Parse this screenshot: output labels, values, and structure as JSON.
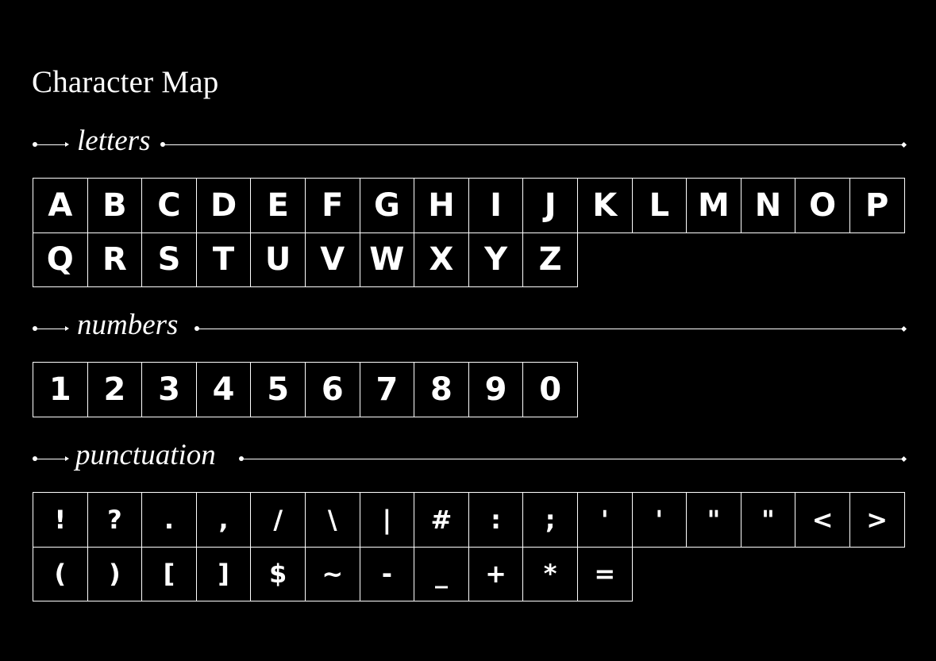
{
  "title": "Character Map",
  "sections": [
    {
      "label": "letters",
      "chars": [
        "A",
        "B",
        "C",
        "D",
        "E",
        "F",
        "G",
        "H",
        "I",
        "J",
        "K",
        "L",
        "M",
        "N",
        "O",
        "P",
        "Q",
        "R",
        "S",
        "T",
        "U",
        "V",
        "W",
        "X",
        "Y",
        "Z"
      ]
    },
    {
      "label": "numbers",
      "chars": [
        "1",
        "2",
        "3",
        "4",
        "5",
        "6",
        "7",
        "8",
        "9",
        "0"
      ]
    },
    {
      "label": "punctuation",
      "chars": [
        "!",
        "?",
        ".",
        ",",
        "/",
        "\\",
        "|",
        "#",
        ":",
        ";",
        "'",
        "'",
        "\"",
        "\"",
        "<",
        ">",
        "(",
        ")",
        "[",
        "]",
        "$",
        "~",
        "-",
        "_",
        "+",
        "*",
        "="
      ]
    }
  ],
  "colors": {
    "background": "#000000",
    "foreground": "#ffffff"
  }
}
